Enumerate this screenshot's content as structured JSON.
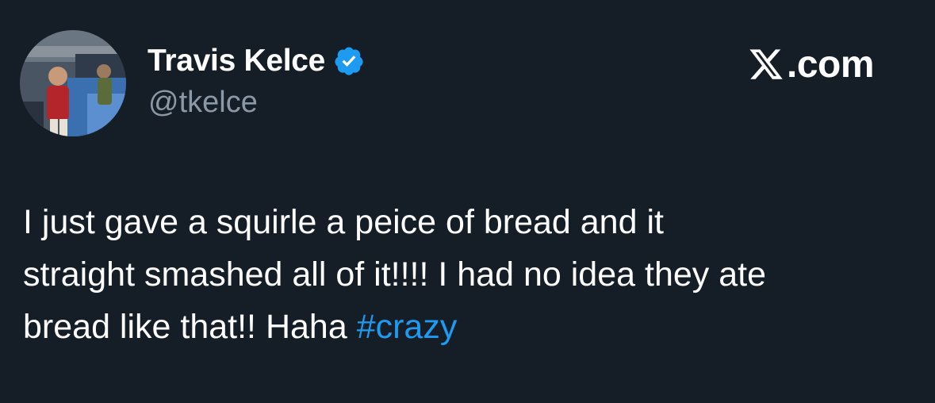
{
  "author": {
    "name": "Travis Kelce",
    "handle": "@tkelce",
    "verified": true
  },
  "site": {
    "domain": ".com",
    "logo_icon": "x-logo-icon"
  },
  "tweet": {
    "lines": [
      "I just gave a squirle a peice of bread and it",
      "straight smashed all of it!!!! I had no idea they ate",
      "bread like that!! Haha "
    ],
    "hashtag": "#crazy"
  },
  "colors": {
    "background": "#151d27",
    "text": "#ffffff",
    "handle": "#8b98a5",
    "hashtag": "#1d9bf0",
    "verified_badge": "#1d9bf0"
  }
}
